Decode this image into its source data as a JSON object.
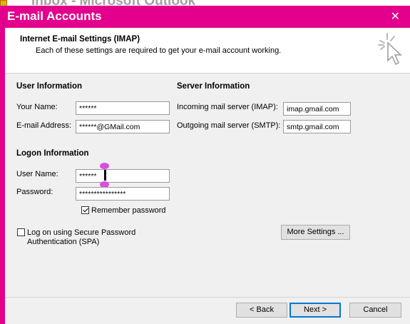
{
  "background": {
    "app_title": "Inbox - Microsoft Outlook"
  },
  "window": {
    "title": "E-mail Accounts",
    "close_glyph": "✕"
  },
  "header": {
    "title": "Internet E-mail Settings (IMAP)",
    "subtitle": "Each of these settings are required to get your e-mail account working.",
    "icon": "cursor-sparkle-icon"
  },
  "user_info": {
    "heading": "User Information",
    "name_label": "Your Name:",
    "name_value": "******",
    "email_label": "E-mail Address:",
    "email_value": "******@GMail.com"
  },
  "server_info": {
    "heading": "Server Information",
    "incoming_label": "Incoming mail server (IMAP):",
    "incoming_value": "imap.gmail.com",
    "outgoing_label": "Outgoing mail server (SMTP):",
    "outgoing_value": "smtp.gmail.com"
  },
  "logon_info": {
    "heading": "Logon Information",
    "username_label": "User Name:",
    "username_value": "******",
    "password_label": "Password:",
    "password_value": "****************",
    "remember_label": "Remember password",
    "remember_checked": true,
    "spa_label_line1": "Log on using Secure Password",
    "spa_label_line2": "Authentication (SPA)",
    "spa_checked": false
  },
  "buttons": {
    "more_settings": "More Settings ...",
    "back": "< Back",
    "next": "Next >",
    "cancel": "Cancel"
  },
  "colors": {
    "accent": "#e3008c",
    "dialog_bg": "#f0f0f0"
  }
}
